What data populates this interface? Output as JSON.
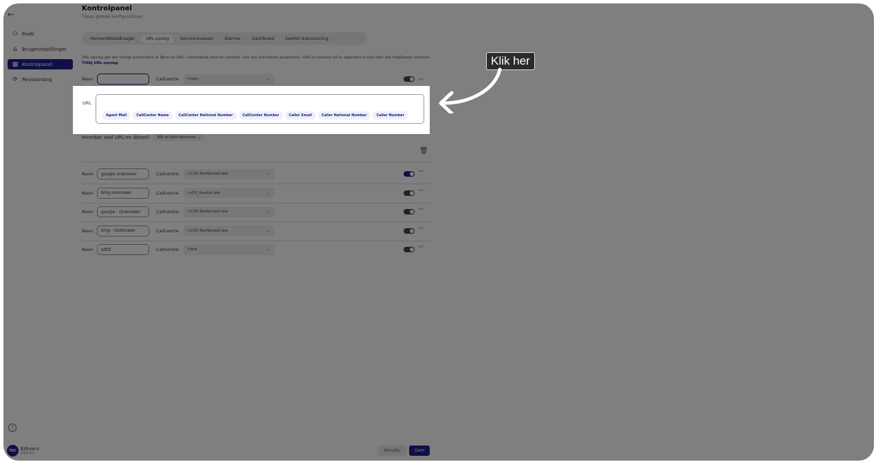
{
  "sidebar": {
    "items": [
      {
        "label": "Profil",
        "icon": "user-icon"
      },
      {
        "label": "Brugerindstillinger",
        "icon": "home-icon"
      },
      {
        "label": "Kontrolpanel",
        "icon": "panel-icon"
      },
      {
        "label": "Revisionslog",
        "icon": "refresh-icon"
      }
    ],
    "active_index": 2,
    "logo_main": "Erhverv",
    "logo_sub": "Softphone",
    "logo_badge": "TDC"
  },
  "header": {
    "title": "Kontrolpanel",
    "subtitle": "Tilpas globale konfigurationer"
  },
  "tabs": [
    {
      "label": "Henvendelsesårsager"
    },
    {
      "label": "URL-opslag"
    },
    {
      "label": "Serviceniveauer"
    },
    {
      "label": "Alarmer"
    },
    {
      "label": "Dashboard"
    },
    {
      "label": "Samlet statusvisning"
    }
  ],
  "description": {
    "text": "URL-opslag gør det muligt automatisk at åbne en URL i forbindelse med en samtale. Der kan inkluderes parametre i URL'en baseret på fx agentens e-mail eller det indgående nummer.",
    "link": "Tilføj URL-opslag"
  },
  "labels": {
    "name": "Navn",
    "callcentre": "Callcentre",
    "url": "URL",
    "how_open": "Hvordan skal URL'en åbnes?",
    "how_open_value": "Når et kald besvares",
    "cancel": "Annuller",
    "save": "Gem"
  },
  "editing_row": {
    "name": "",
    "callcentre": "Ingen",
    "enabled": false
  },
  "chips": [
    "Agent Mail",
    "CallCenter Name",
    "CallCenter National Number",
    "CallCenter Number",
    "Caller Email",
    "Caller National Number",
    "Caller Number"
  ],
  "rows": [
    {
      "name": "google onAnswer",
      "callcentre": "CCOS RedVelvetCake",
      "enabled": true
    },
    {
      "name": "bing onAnswer",
      "callcentre": "cc03_VanillaCake",
      "enabled": false
    },
    {
      "name": "google - OnAnswer",
      "callcentre": "CCOS RedVelvetCake",
      "enabled": false
    },
    {
      "name": "bing - OnAnswer",
      "callcentre": "CCOS RedVelvetCake",
      "enabled": false
    },
    {
      "name": "sdfsf",
      "callcentre": "Flere",
      "enabled": false
    }
  ],
  "callout": {
    "text": "Klik her"
  },
  "colors": {
    "accent": "#20208c"
  }
}
